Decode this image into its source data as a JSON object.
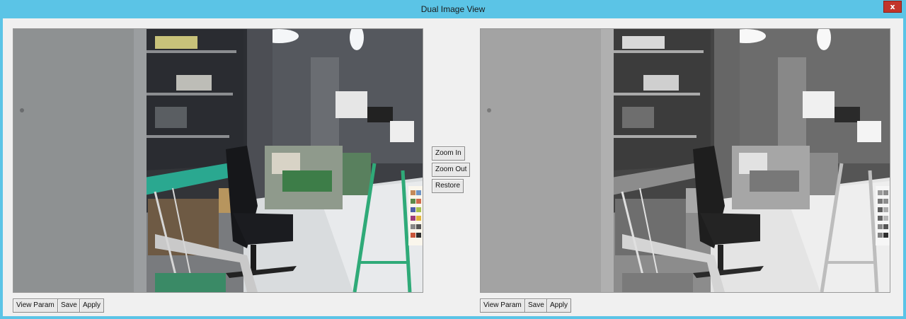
{
  "window": {
    "title": "Dual Image View",
    "close_label": "x"
  },
  "center_controls": {
    "zoom_in": "Zoom In",
    "zoom_out": "Zoom Out",
    "restore": "Restore"
  },
  "left_panel": {
    "image_mode": "color",
    "buttons": {
      "view_param": "View Param",
      "save": "Save",
      "apply": "Apply"
    }
  },
  "right_panel": {
    "image_mode": "grayscale",
    "buttons": {
      "view_param": "View Param",
      "save": "Save",
      "apply": "Apply"
    }
  },
  "colors": {
    "title_bar": "#5bc4e6",
    "client_bg": "#f0f0f0",
    "close_button": "#c2352b"
  }
}
